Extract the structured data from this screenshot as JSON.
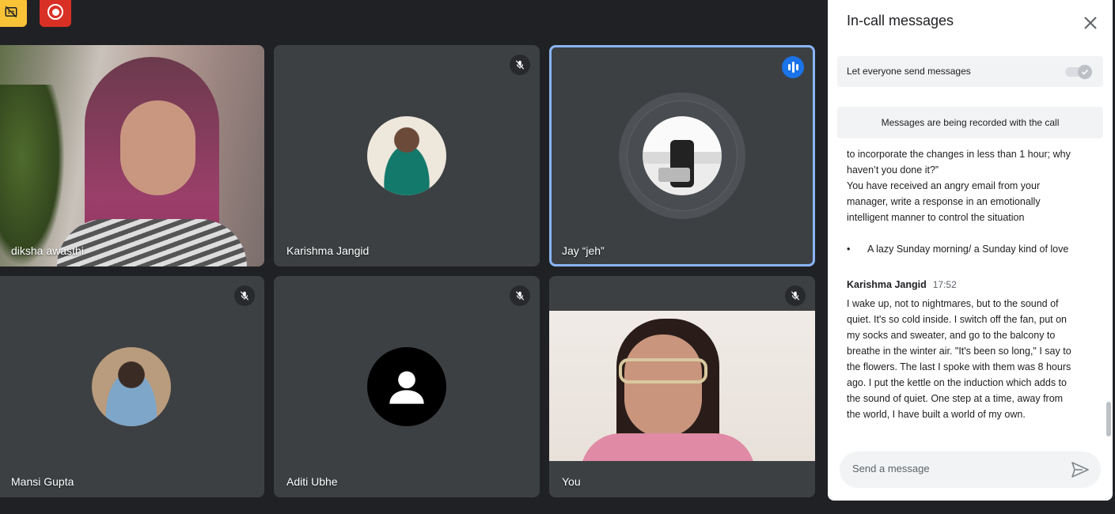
{
  "participants": [
    {
      "name": "diksha awasthi"
    },
    {
      "name": "Karishma Jangid"
    },
    {
      "name": "Jay “jeh”"
    },
    {
      "name": "Mansi Gupta"
    },
    {
      "name": "Aditi Ubhe"
    },
    {
      "name": "You"
    }
  ],
  "panel": {
    "title": "In-call messages",
    "toggle_label": "Let everyone send messages",
    "toggle_on": true,
    "recording_notice": "Messages are being recorded with the call",
    "messages": {
      "cont_lines": [
        "to incorporate the changes in less than 1 hour; why",
        "haven’t you done it?”",
        "You have received an angry email from your",
        "manager, write a response in an emotionally",
        "intelligent manner to control the situation"
      ],
      "bullet_marker": "•",
      "bullet_text": "A lazy Sunday morning/ a Sunday kind of love",
      "sender": "Karishma Jangid",
      "time": "17:52",
      "body_lines": [
        "I wake up, not to nightmares, but to the sound of",
        "quiet. It's so cold inside. I switch off the fan, put on",
        "my socks and sweater, and go to the balcony to",
        "breathe in the winter air. \"It's been so long,\" I say to",
        "the flowers. The last I spoke with them was 8 hours",
        "ago. I put the kettle on the induction which adds to",
        "the sound of quiet. One step at a time, away from",
        "the world, I have built a world of my own."
      ]
    },
    "composer_placeholder": "Send a message"
  },
  "colors": {
    "background": "#202124",
    "tile": "#3c4043",
    "active_speaker_border": "#8ab4f8",
    "speaking_indicator": "#1a73e8",
    "recording": "#d93025",
    "warning": "#f9c338"
  }
}
